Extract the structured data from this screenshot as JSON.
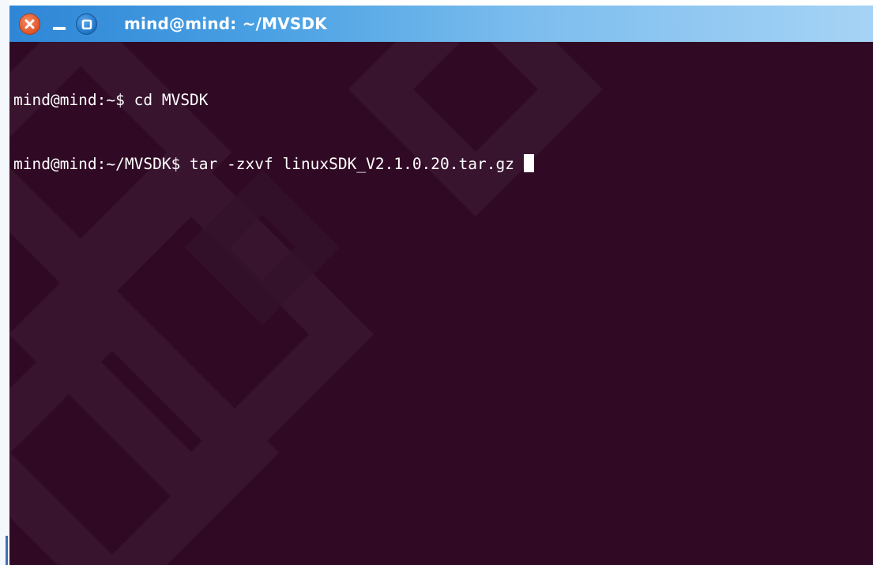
{
  "window": {
    "title": "mind@mind: ~/MVSDK",
    "controls": {
      "close_icon": "close-icon",
      "minimize_icon": "minimize-icon",
      "maximize_icon": "maximize-icon"
    },
    "colors": {
      "titlebar_start": "#2e86d6",
      "titlebar_end": "#a6d3f5",
      "close": "#e0552a",
      "maximize": "#1e74c6"
    }
  },
  "terminal": {
    "background": "#300a24",
    "foreground": "#ffffff",
    "lines": [
      "mind@mind:~$ cd MVSDK",
      "mind@mind:~/MVSDK$ tar -zxvf linuxSDK_V2.1.0.20.tar.gz"
    ],
    "cursor": "block-cursor"
  }
}
